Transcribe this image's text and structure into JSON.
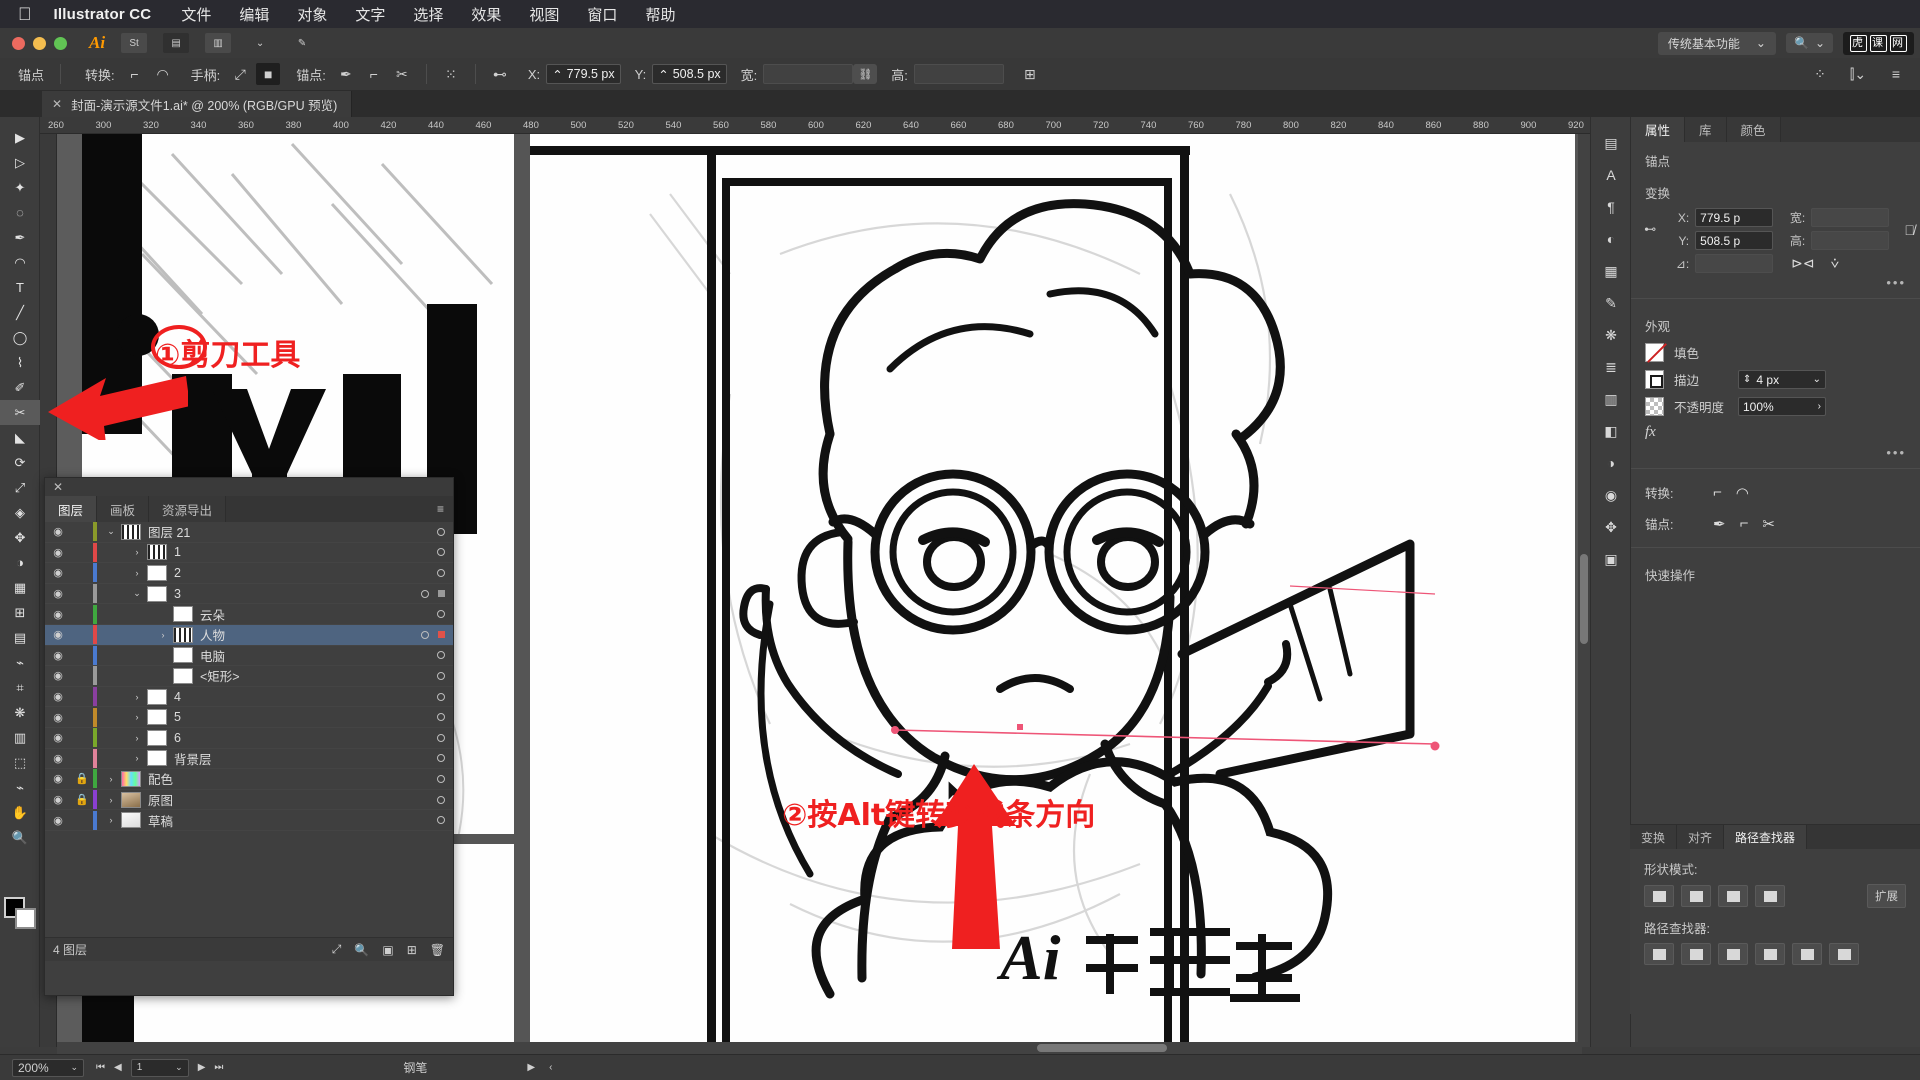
{
  "menubar": {
    "apple_icon": "apple-logo",
    "app_name": "Illustrator CC",
    "items": [
      "文件",
      "编辑",
      "对象",
      "文字",
      "选择",
      "效果",
      "视图",
      "窗口",
      "帮助"
    ]
  },
  "titlestrip": {
    "workspace": "传统基本功能",
    "search_placeholder": "搜索",
    "brand": "虎课网"
  },
  "controlbar": {
    "label": "锚点",
    "convert_label": "转换:",
    "handle_label": "手柄:",
    "anchor_label": "锚点:",
    "x_label": "X:",
    "x_value": "779.5 px",
    "y_label": "Y:",
    "y_value": "508.5 px",
    "w_label": "宽:",
    "w_value": "",
    "h_label": "高:",
    "h_value": ""
  },
  "document_tab": {
    "close_icon": "✕",
    "title": "封面-演示源文件1.ai* @ 200% (RGB/GPU 预览)"
  },
  "ruler": {
    "ticks": [
      "260",
      "300",
      "320",
      "340",
      "360",
      "380",
      "400",
      "420",
      "440",
      "460",
      "480",
      "500",
      "520",
      "540",
      "560",
      "580",
      "600",
      "620",
      "640",
      "660",
      "680",
      "700",
      "720",
      "740",
      "760",
      "780",
      "800",
      "820",
      "840",
      "860",
      "880",
      "900",
      "920"
    ]
  },
  "tools": {
    "items": [
      {
        "name": "selection-tool",
        "glyph": "▶"
      },
      {
        "name": "direct-selection-tool",
        "glyph": "▷"
      },
      {
        "name": "magic-wand-tool",
        "glyph": "✦"
      },
      {
        "name": "lasso-tool",
        "glyph": "✎"
      },
      {
        "name": "pen-tool",
        "glyph": "✒"
      },
      {
        "name": "curvature-tool",
        "glyph": "◠"
      },
      {
        "name": "type-tool",
        "glyph": "T"
      },
      {
        "name": "line-segment-tool",
        "glyph": "╱"
      },
      {
        "name": "ellipse-tool",
        "glyph": "◯"
      },
      {
        "name": "paintbrush-tool",
        "glyph": "🖌"
      },
      {
        "name": "shaper-tool",
        "glyph": "✐"
      },
      {
        "name": "scissors-tool",
        "glyph": "✂"
      },
      {
        "name": "rotate-tool",
        "glyph": "⟳"
      },
      {
        "name": "scale-tool",
        "glyph": "⤢"
      },
      {
        "name": "width-tool",
        "glyph": "◈"
      },
      {
        "name": "free-transform-tool",
        "glyph": "✥"
      },
      {
        "name": "shape-builder-tool",
        "glyph": "◑"
      },
      {
        "name": "perspective-grid-tool",
        "glyph": "▦"
      },
      {
        "name": "mesh-tool",
        "glyph": "⊞"
      },
      {
        "name": "gradient-tool",
        "glyph": "▤"
      },
      {
        "name": "eyedropper-tool",
        "glyph": "⌇"
      },
      {
        "name": "blend-tool",
        "glyph": "⌗"
      },
      {
        "name": "symbol-sprayer-tool",
        "glyph": "❋"
      },
      {
        "name": "column-graph-tool",
        "glyph": "▥"
      },
      {
        "name": "artboard-tool",
        "glyph": "⬚"
      },
      {
        "name": "slice-tool",
        "glyph": "⌁"
      },
      {
        "name": "hand-tool",
        "glyph": "✋"
      },
      {
        "name": "zoom-tool",
        "glyph": "🔍"
      }
    ]
  },
  "layers_panel": {
    "close_icon": "✕",
    "tabs": [
      "图层",
      "画板",
      "资源导出"
    ],
    "active_tab": "图层",
    "menu_icon": "≡",
    "rows": [
      {
        "indent": 0,
        "disclosure": "v",
        "name": "图层 21",
        "color": "#8a9a2a",
        "locked": false,
        "selected": false,
        "target": "circle",
        "thumb": "art"
      },
      {
        "indent": 1,
        "disclosure": ">",
        "name": "1",
        "color": "#e04848",
        "locked": false,
        "selected": false,
        "target": "circle",
        "thumb": "art"
      },
      {
        "indent": 1,
        "disclosure": ">",
        "name": "2",
        "color": "#4a7ad0",
        "locked": false,
        "selected": false,
        "target": "circle",
        "thumb": "blank"
      },
      {
        "indent": 1,
        "disclosure": "v",
        "name": "3",
        "color": "#9a9a9a",
        "locked": false,
        "selected": false,
        "target": "circle-square",
        "thumb": "blank"
      },
      {
        "indent": 2,
        "disclosure": "",
        "name": "云朵",
        "color": "#3fa83f",
        "locked": false,
        "selected": false,
        "target": "circle",
        "thumb": "blank"
      },
      {
        "indent": 2,
        "disclosure": ">",
        "name": "人物",
        "color": "#e04848",
        "locked": false,
        "selected": true,
        "target": "circle-square-red",
        "thumb": "art"
      },
      {
        "indent": 2,
        "disclosure": "",
        "name": "电脑",
        "color": "#4a7ad0",
        "locked": false,
        "selected": false,
        "target": "circle",
        "thumb": "blank"
      },
      {
        "indent": 2,
        "disclosure": "",
        "name": "<矩形>",
        "color": "#9a9a9a",
        "locked": false,
        "selected": false,
        "target": "circle",
        "thumb": "blank"
      },
      {
        "indent": 1,
        "disclosure": ">",
        "name": "4",
        "color": "#8a3fa0",
        "locked": false,
        "selected": false,
        "target": "circle",
        "thumb": "blank"
      },
      {
        "indent": 1,
        "disclosure": ">",
        "name": "5",
        "color": "#c08a2a",
        "locked": false,
        "selected": false,
        "target": "circle",
        "thumb": "blank"
      },
      {
        "indent": 1,
        "disclosure": ">",
        "name": "6",
        "color": "#7aa82a",
        "locked": false,
        "selected": false,
        "target": "circle",
        "thumb": "blank"
      },
      {
        "indent": 1,
        "disclosure": ">",
        "name": "背景层",
        "color": "#e0829a",
        "locked": false,
        "selected": false,
        "target": "circle",
        "thumb": "blank"
      },
      {
        "indent": 0,
        "disclosure": ">",
        "name": "配色",
        "color": "#3fa83f",
        "locked": true,
        "selected": false,
        "target": "circle",
        "thumb": "swatch"
      },
      {
        "indent": 0,
        "disclosure": ">",
        "name": "原图",
        "color": "#8a3fd0",
        "locked": true,
        "selected": false,
        "target": "circle",
        "thumb": "photo"
      },
      {
        "indent": 0,
        "disclosure": ">",
        "name": "草稿",
        "color": "#4a7ad0",
        "locked": false,
        "selected": false,
        "target": "circle",
        "thumb": "sketch"
      }
    ],
    "footer": {
      "count_label": "4 图层",
      "icons": [
        "locate-object-icon",
        "make-clipping-mask-icon",
        "create-new-sublayer-icon",
        "create-new-layer-icon",
        "delete-selection-icon"
      ]
    }
  },
  "annotations": {
    "step1": "①剪刀工具",
    "step2": "②按Alt键转变线条方向"
  },
  "properties_panel": {
    "tabs": [
      "属性",
      "库",
      "颜色"
    ],
    "active_tab": "属性",
    "anchor_section": "锚点",
    "transform_section": "变换",
    "x_label": "X:",
    "x_value": "779.5 p",
    "y_label": "Y:",
    "y_value": "508.5 p",
    "w_label": "宽:",
    "w_value": "",
    "h_label": "高:",
    "h_value": "",
    "angle_label": "⊿:",
    "angle_value": "",
    "link_icon": "broken-link-icon",
    "flip_h_icon": "flip-horizontal-icon",
    "flip_v_icon": "flip-vertical-icon",
    "appearance_section": "外观",
    "fill_label": "填色",
    "stroke_label": "描边",
    "stroke_value": "4 px",
    "opacity_label": "不透明度",
    "opacity_value": "100%",
    "fx_label": "fx",
    "convert_label": "转换:",
    "anchor_tools_label": "锚点:",
    "quick_actions": "快速操作",
    "more_dots": "•••"
  },
  "pathfinder_panel": {
    "tabs": [
      "变换",
      "对齐",
      "路径查找器"
    ],
    "active_tab": "路径查找器",
    "shape_modes_label": "形状模式:",
    "expand_label": "扩展",
    "pathfinders_label": "路径查找器:"
  },
  "statusbar": {
    "zoom": "200%",
    "page": "1",
    "tool": "钢笔",
    "nav_first": "⏮",
    "nav_prev": "◀",
    "nav_next": "▶",
    "nav_last": "⏭"
  },
  "colors": {
    "accent_red": "#ef2020",
    "selection_blue": "#4e6480",
    "panel_bg": "#3f3f3f",
    "canvas_bg": "#555555"
  }
}
